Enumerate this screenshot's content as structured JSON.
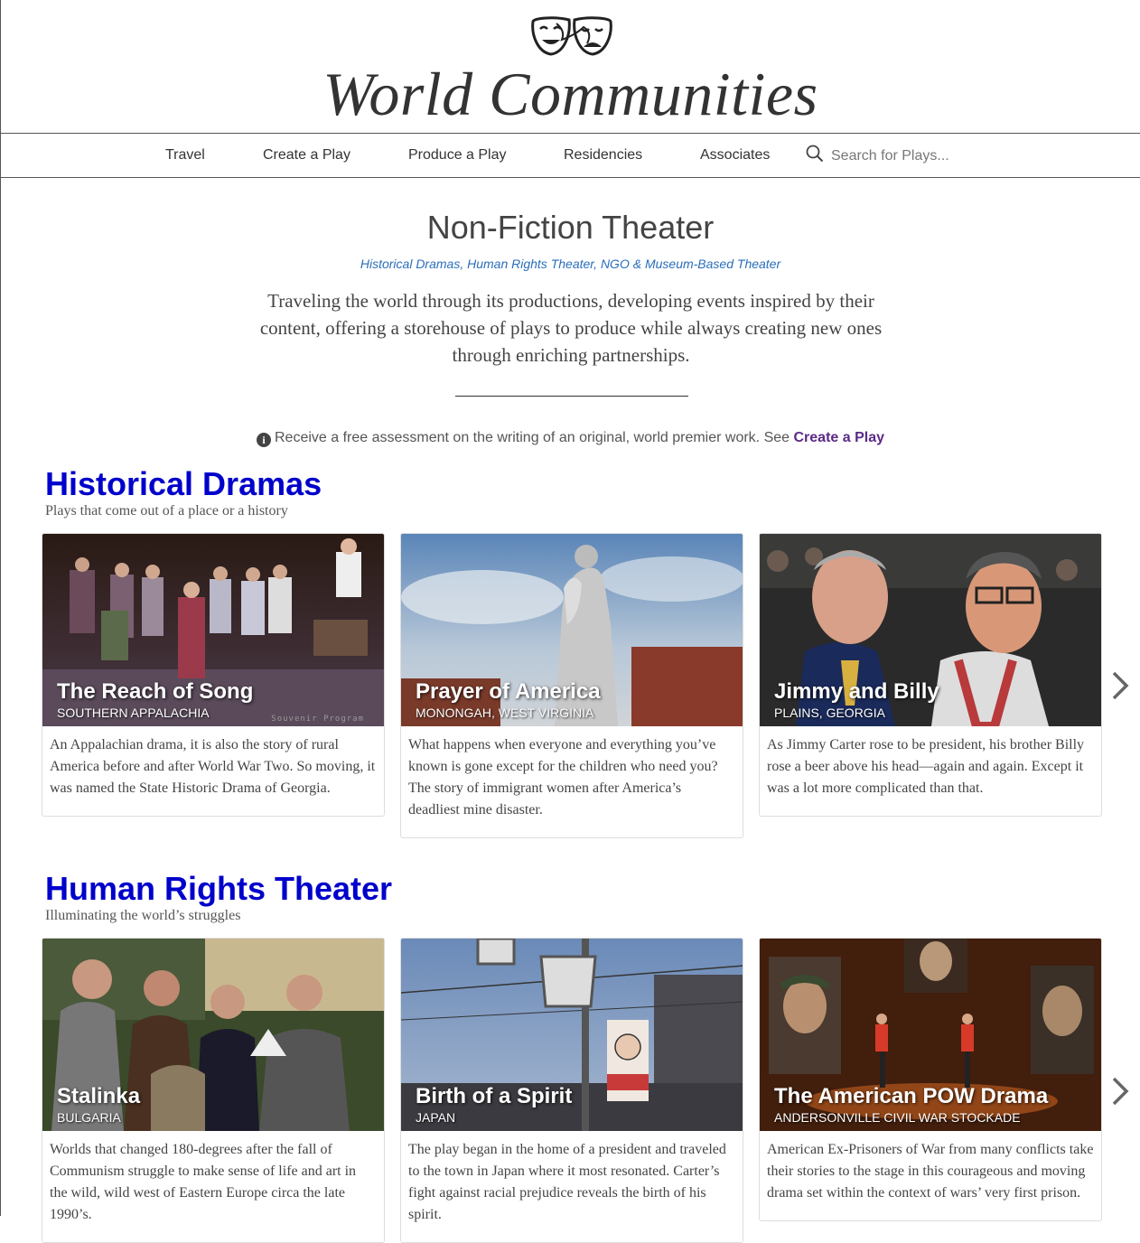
{
  "site": {
    "title": "World Communities"
  },
  "nav": {
    "items": [
      "Travel",
      "Create a Play",
      "Produce a Play",
      "Residencies",
      "Associates"
    ],
    "search_placeholder": "Search for Plays..."
  },
  "hero": {
    "title": "Non-Fiction Theater",
    "subtitle": "Historical Dramas, Human Rights Theater, NGO & Museum-Based Theater",
    "description": "Traveling the world through its productions, developing events inspired by their content, offering a storehouse of plays to produce while always creating new ones through enriching partnerships."
  },
  "notice": {
    "text": "Receive a free assessment on the writing of an original, world premier work. See ",
    "link": "Create a Play"
  },
  "sections": [
    {
      "title": "Historical Dramas",
      "subtitle": "Plays that come out of a place or a history",
      "cards": [
        {
          "title": "The Reach of Song",
          "location": "SOUTHERN APPALACHIA",
          "image_overlay": "Souvenir Program",
          "text": "An Appalachian drama, it is also the story of rural America before and after World War Two. So moving, it was named the State Historic Drama of Georgia."
        },
        {
          "title": "Prayer of America",
          "location": "MONONGAH, WEST VIRGINIA",
          "text": "What happens when everyone and everything you’ve known is gone except for the children who need you? The story of immigrant women after America’s deadliest mine disaster."
        },
        {
          "title": "Jimmy and Billy",
          "location": "PLAINS, GEORGIA",
          "text": "As Jimmy Carter rose to be president, his brother Billy rose a beer above his head—again and again. Except it was a lot more complicated than that."
        }
      ]
    },
    {
      "title": "Human Rights Theater",
      "subtitle": "Illuminating the world’s struggles",
      "cards": [
        {
          "title": "Stalinka",
          "location": "BULGARIA",
          "text": "Worlds that changed 180-degrees after the fall of Communism struggle to make sense of life and art in the wild, wild west of Eastern Europe circa the late 1990’s."
        },
        {
          "title": "Birth of a Spirit",
          "location": "JAPAN",
          "text": "The play began in the home of a president and traveled to the town in Japan where it most resonated. Carter’s fight against racial prejudice reveals the birth of his spirit."
        },
        {
          "title": "The American POW Drama",
          "location": "ANDERSONVILLE CIVIL WAR STOCKADE",
          "text": "American Ex-Prisoners of War from many conflicts take their stories to the stage in this courageous and moving drama set within the context of wars’ very first prison."
        }
      ]
    }
  ]
}
